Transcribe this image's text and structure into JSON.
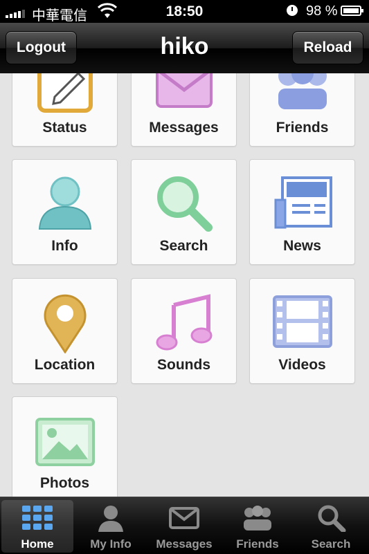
{
  "status_bar": {
    "carrier": "中華電信",
    "time": "18:50",
    "battery": "98 %",
    "icons": [
      "signal-icon",
      "wifi-icon",
      "clock-icon",
      "battery-icon"
    ]
  },
  "nav": {
    "title": "hiko",
    "left_button": "Logout",
    "right_button": "Reload"
  },
  "grid": {
    "tiles": [
      {
        "label": "Status",
        "icon": "status-icon"
      },
      {
        "label": "Messages",
        "icon": "mail-icon"
      },
      {
        "label": "Friends",
        "icon": "friends-icon"
      },
      {
        "label": "Info",
        "icon": "person-icon"
      },
      {
        "label": "Search",
        "icon": "magnifier-icon"
      },
      {
        "label": "News",
        "icon": "newspaper-icon"
      },
      {
        "label": "Location",
        "icon": "map-pin-icon"
      },
      {
        "label": "Sounds",
        "icon": "music-note-icon"
      },
      {
        "label": "Videos",
        "icon": "film-icon"
      },
      {
        "label": "Photos",
        "icon": "picture-icon"
      }
    ]
  },
  "tab_bar": {
    "tabs": [
      {
        "label": "Home",
        "icon": "home-grid-icon",
        "active": true
      },
      {
        "label": "My Info",
        "icon": "person-icon",
        "active": false
      },
      {
        "label": "Messages",
        "icon": "mail-icon",
        "active": false
      },
      {
        "label": "Friends",
        "icon": "friends-icon",
        "active": false
      },
      {
        "label": "Search",
        "icon": "magnifier-icon",
        "active": false
      }
    ]
  },
  "colors": {
    "status_orange": "#e0a93a",
    "messages_purple": "#c57cc8",
    "friends_blue": "#8a9ee0",
    "info_teal": "#6fc1c4",
    "search_green": "#7fcf9a",
    "news_blue": "#6b8fd6",
    "location_gold": "#e1b456",
    "sounds_pink": "#d77fd0",
    "videos_blue": "#8ea0dc",
    "photos_green": "#8fd0a0"
  }
}
